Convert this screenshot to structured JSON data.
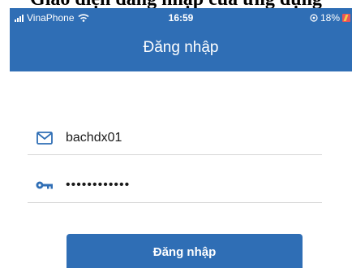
{
  "caption": "Giao diện đăng nhập của ứng dụng",
  "statusbar": {
    "carrier": "VinaPhone",
    "time": "16:59",
    "battery": "18%"
  },
  "header": {
    "title": "Đăng nhập"
  },
  "form": {
    "username_value": "bachdx01",
    "password_value": "••••••••••••"
  },
  "actions": {
    "login_label": "Đăng nhập"
  },
  "colors": {
    "primary": "#2f6eb5",
    "divider": "#d6d6d6",
    "icon": "#2f6eb5"
  },
  "icons": {
    "username": "mail-icon",
    "password": "key-icon"
  }
}
